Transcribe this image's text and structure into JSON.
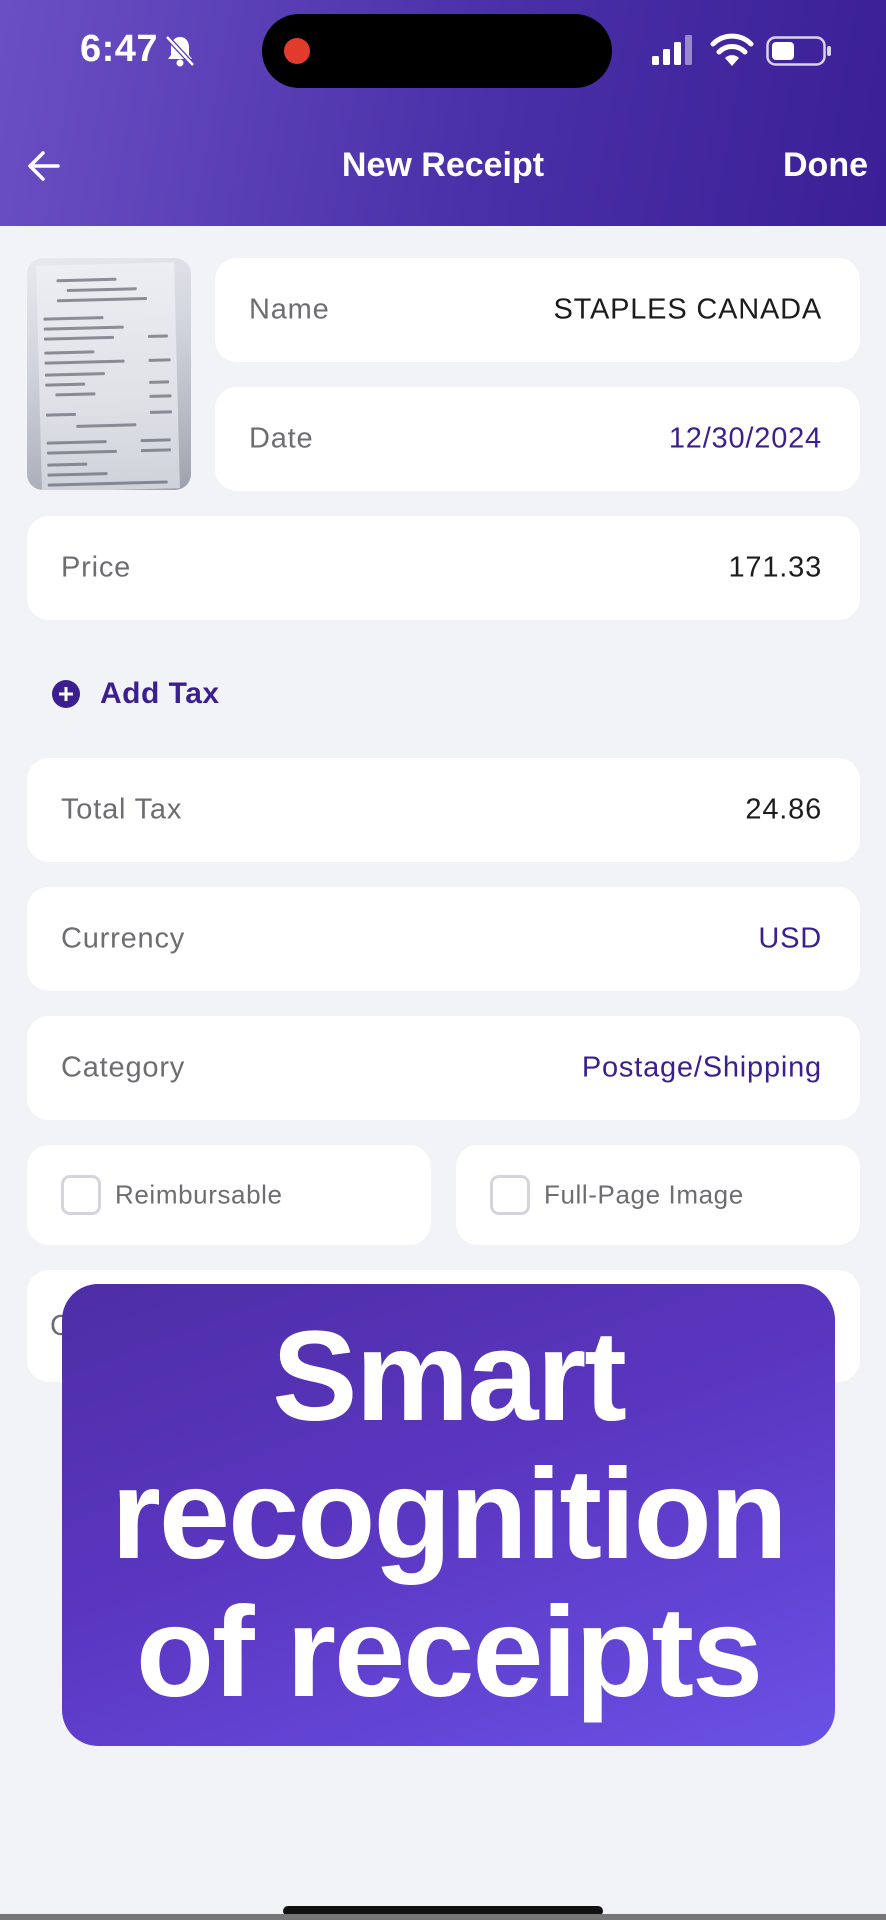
{
  "status_bar": {
    "time": "6:47",
    "icons": [
      "bell-slash-icon",
      "cellular-signal-icon",
      "wifi-icon",
      "battery-icon"
    ]
  },
  "nav": {
    "back_icon": "arrow-left-icon",
    "title": "New Receipt",
    "done_label": "Done"
  },
  "form": {
    "name_label": "Name",
    "name_value": "STAPLES CANADA",
    "date_label": "Date",
    "date_value": "12/30/2024",
    "price_label": "Price",
    "price_value": "171.33",
    "add_tax_label": "Add Tax",
    "total_tax_label": "Total Tax",
    "total_tax_value": "24.86",
    "currency_label": "Currency",
    "currency_value": "USD",
    "category_label": "Category",
    "category_value": "Postage/Shipping",
    "reimbursable_label": "Reimbursable",
    "reimbursable_checked": false,
    "full_page_label": "Full-Page Image",
    "full_page_checked": false,
    "partial_label": "C"
  },
  "promo": {
    "line1": "Smart",
    "line2": "recognition",
    "line3": "of receipts"
  },
  "colors": {
    "header_gradient_start": "#6a4fc4",
    "header_gradient_end": "#3a1f96",
    "accent": "#3b1f8f",
    "background": "#f2f3f7",
    "promo_gradient_start": "#4e2ea6",
    "promo_gradient_end": "#6a52e6"
  }
}
